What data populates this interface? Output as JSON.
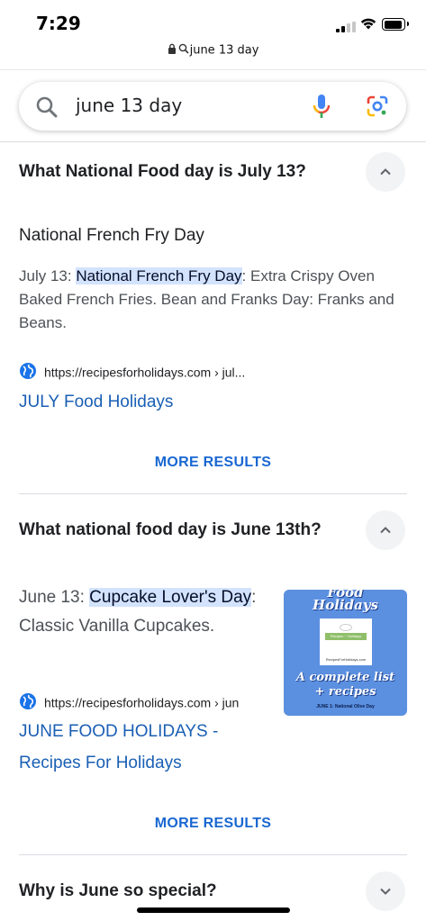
{
  "status_bar": {
    "time": "7:29"
  },
  "browser": {
    "url_text": "june 13 day"
  },
  "search": {
    "query": "june 13 day"
  },
  "colors": {
    "link": "#1a5fb4",
    "more_results": "#1967d2",
    "highlight": "#d3e3fd",
    "chevron_bg": "#f1f3f4"
  },
  "faq": [
    {
      "question": "What National Food day is July 13?",
      "answer_title": "National French Fry Day",
      "snippet_before": "July 13: ",
      "snippet_highlight": "National French Fry Day",
      "snippet_after": ": Extra Crispy Oven Baked French Fries. Bean and Franks Day: Franks and Beans.",
      "source_url": "https://recipesforholidays.com › jul...",
      "link_title": "JULY Food Holidays",
      "more_label": "MORE RESULTS",
      "expanded": true
    },
    {
      "question": "What national food day is June 13th?",
      "snippet_before": "June 13: ",
      "snippet_highlight": "Cupcake Lover's Day",
      "snippet_after": ": Classic Vanilla Cupcakes.",
      "source_url": "https://recipesforholidays.com › jun",
      "link_title_line1": "JUNE FOOD HOLIDAYS -",
      "link_title_line2": "Recipes For Holidays",
      "more_label": "MORE RESULTS",
      "thumbnail": {
        "line_top": "Food",
        "line_main": "Holidays",
        "card_badge": "Recipes ~ Holidays",
        "card_site": "RecipesForHolidays.com",
        "caption_line1": "A complete list",
        "caption_line2": "+ recipes",
        "footer": "JUNE 1: National Olive Day"
      },
      "expanded": true
    },
    {
      "question": "Why is June so special?",
      "expanded": false
    }
  ]
}
